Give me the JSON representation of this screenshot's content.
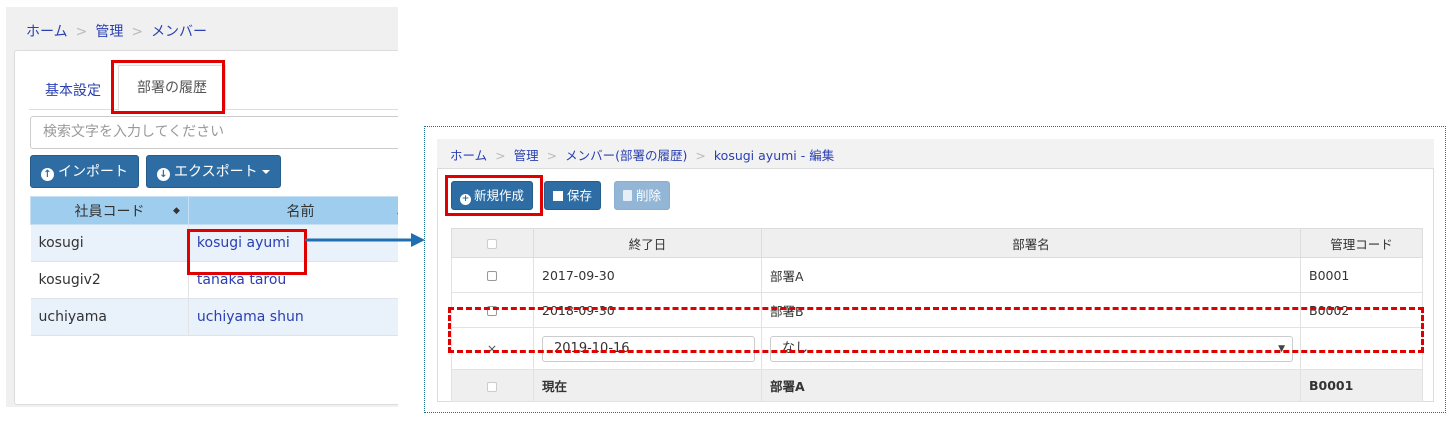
{
  "left": {
    "breadcrumb": {
      "home": "ホーム",
      "admin": "管理",
      "current": "メンバー",
      "separator": ">"
    },
    "tabs": [
      {
        "label": "基本設定"
      },
      {
        "label": "部署の履歴"
      }
    ],
    "search": {
      "placeholder": "検索文字を入力してください"
    },
    "buttons": {
      "import": "インポート",
      "export": "エクスポート"
    },
    "table": {
      "columns": [
        "社員コード",
        "名前"
      ],
      "rows": [
        {
          "code": "kosugi",
          "name": "kosugi ayumi"
        },
        {
          "code": "kosugiv2",
          "name": "tanaka tarou"
        },
        {
          "code": "uchiyama",
          "name": "uchiyama shun"
        }
      ]
    }
  },
  "right": {
    "breadcrumb": {
      "home": "ホーム",
      "admin": "管理",
      "members": "メンバー(部署の履歴)",
      "current": "kosugi ayumi - 編集",
      "separator": ">"
    },
    "buttons": {
      "new": "新規作成",
      "save": "保存",
      "delete": "削除"
    },
    "table": {
      "columns": [
        "終了日",
        "部署名",
        "管理コード"
      ],
      "rows": [
        {
          "end_date": "2017-09-30",
          "dept": "部署A",
          "code": "B0001"
        },
        {
          "end_date": "2018-09-30",
          "dept": "部署B",
          "code": "B0002"
        }
      ],
      "edit_row": {
        "remove": "×",
        "end_date": "2019-10-16",
        "dept": "なし"
      },
      "current_row": {
        "label": "現在",
        "dept": "部署A",
        "code": "B0001"
      }
    }
  },
  "colors": {
    "accent": "#2e6da4",
    "highlight": "#e00000",
    "header_blue": "#9fcdee"
  }
}
